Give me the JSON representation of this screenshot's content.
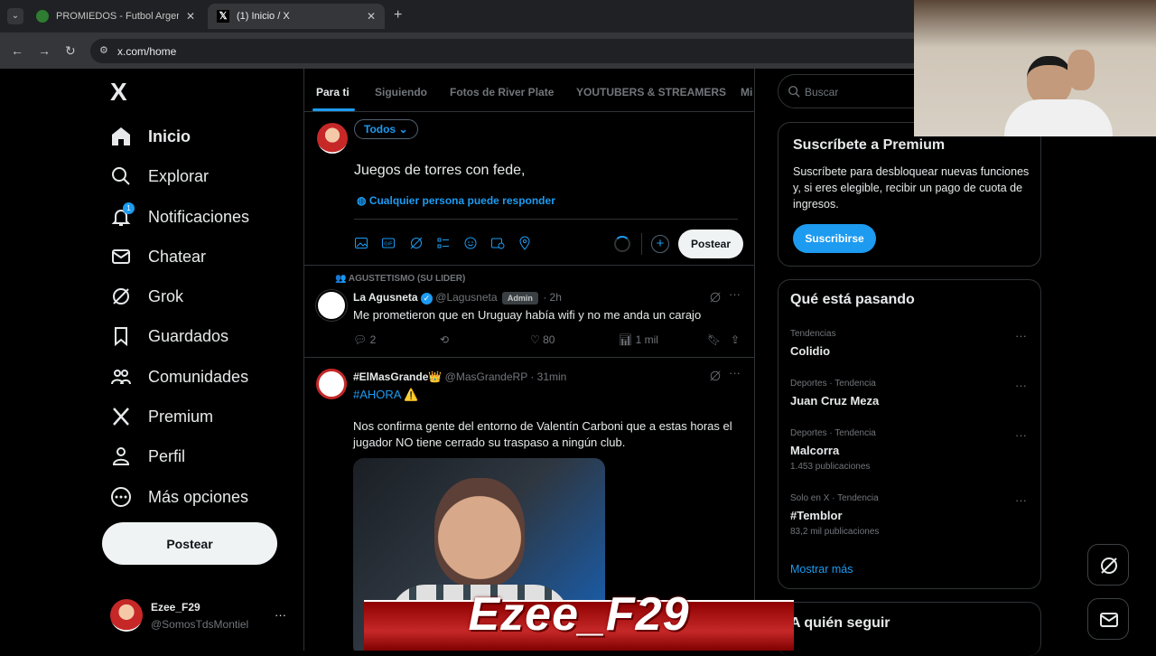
{
  "browser": {
    "tabs": [
      {
        "label": "PROMIEDOS - Futbol Argentino",
        "active": false
      },
      {
        "label": "(1) Inicio / X",
        "active": true
      }
    ],
    "new_tab": "+",
    "url": "x.com/home"
  },
  "sidebar": {
    "logo": "X",
    "items": [
      {
        "label": "Inicio",
        "icon": "home-icon"
      },
      {
        "label": "Explorar",
        "icon": "search-icon"
      },
      {
        "label": "Notificaciones",
        "icon": "bell-icon",
        "badge": "1"
      },
      {
        "label": "Chatear",
        "icon": "mail-icon"
      },
      {
        "label": "Grok",
        "icon": "grok-icon"
      },
      {
        "label": "Guardados",
        "icon": "bookmark-icon"
      },
      {
        "label": "Comunidades",
        "icon": "people-icon"
      },
      {
        "label": "Premium",
        "icon": "x-icon"
      },
      {
        "label": "Perfil",
        "icon": "person-icon"
      },
      {
        "label": "Más opciones",
        "icon": "more-icon"
      }
    ],
    "post_button": "Postear",
    "account": {
      "name": "Ezee_F29",
      "handle": "@SomosTdsMontiel",
      "more": "···"
    }
  },
  "feed_tabs": [
    "Para ti",
    "Siguiendo",
    "Fotos de River Plate",
    "YOUTUBERS & STREAMERS",
    "Mi"
  ],
  "composer": {
    "audience": "Todos",
    "text": "Juegos de torres con fede,",
    "reply_setting": "Cualquier persona puede responder",
    "post_button": "Postear"
  },
  "posts": [
    {
      "context": "AGUSTETISMO (SU LIDER)",
      "name": "La Agusneta",
      "handle": "@Lagusneta",
      "badge": "Admin",
      "time": "· 2h",
      "text": "Me prometieron que en Uruguay había wifi y no me anda un carajo",
      "replies": "2",
      "likes": "80",
      "views": "1 mil"
    },
    {
      "name": "#ElMasGrande👑",
      "handle": "@MasGrandeRP",
      "time": "· 31min",
      "hashtag": "#AHORA ⚠️",
      "text": "Nos confirma gente del entorno de Valentín Carboni que a estas horas el jugador NO tiene cerrado su traspaso a ningún club."
    }
  ],
  "search": {
    "placeholder": "Buscar"
  },
  "premium": {
    "title": "Suscríbete a Premium",
    "text": "Suscríbete para desbloquear nuevas funciones y, si eres elegible, recibir un pago de cuota de ingresos.",
    "button": "Suscribirse"
  },
  "trends": {
    "title": "Qué está pasando",
    "items": [
      {
        "category": "Tendencias",
        "name": "Colidio",
        "count": ""
      },
      {
        "category": "Deportes · Tendencia",
        "name": "Juan Cruz Meza",
        "count": ""
      },
      {
        "category": "Deportes · Tendencia",
        "name": "Malcorra",
        "count": "1.453 publicaciones"
      },
      {
        "category": "Solo en X · Tendencia",
        "name": "#Temblor",
        "count": "83,2 mil publicaciones"
      }
    ],
    "more": "Mostrar más"
  },
  "who_to_follow": {
    "title": "A quién seguir"
  },
  "overlay": {
    "streamer_name": "Ezee_F29"
  },
  "colors": {
    "accent": "#1d9bf0",
    "background": "#000000",
    "border": "#2f3336",
    "muted": "#71767b",
    "overlay_red": "#c62828"
  }
}
